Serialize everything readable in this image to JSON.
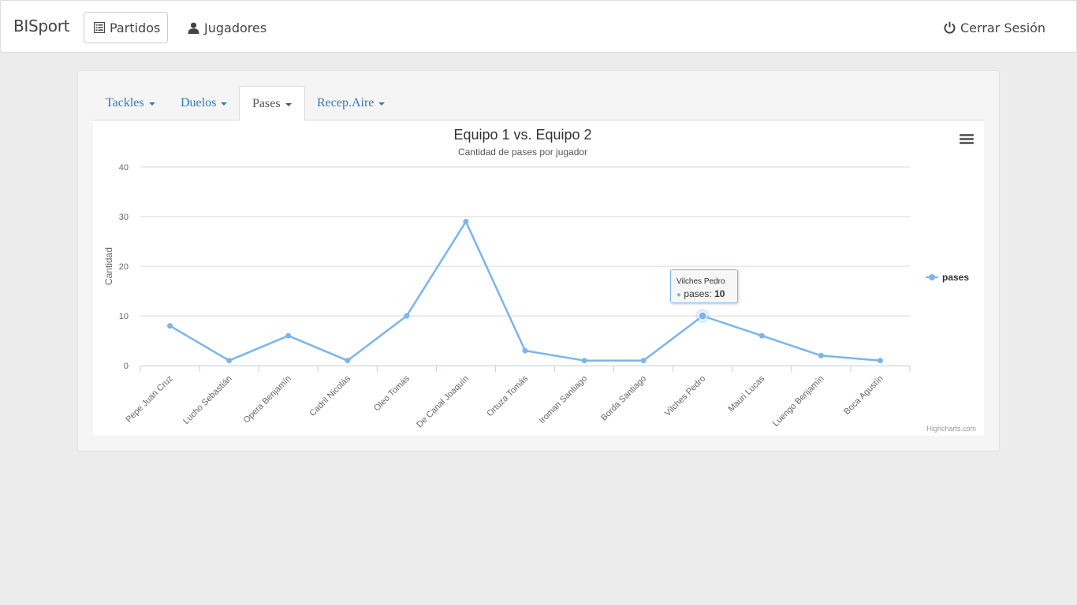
{
  "navbar": {
    "brand": "BISport",
    "items": [
      {
        "label": "Partidos",
        "icon": "list-icon",
        "active": true
      },
      {
        "label": "Jugadores",
        "icon": "user-icon",
        "active": false
      }
    ],
    "logout": {
      "label": "Cerrar Sesión",
      "icon": "power-icon"
    }
  },
  "tabs": [
    {
      "label": "Tackles",
      "active": false
    },
    {
      "label": "Duelos",
      "active": false
    },
    {
      "label": "Pases",
      "active": true
    },
    {
      "label": "Recep.Aire",
      "active": false
    }
  ],
  "chart_data": {
    "type": "line",
    "title": "Equipo 1 vs. Equipo 2",
    "subtitle": "Cantidad de pases por jugador",
    "xlabel": "",
    "ylabel": "Cantidad",
    "ylim": [
      0,
      40
    ],
    "yticks": [
      0,
      10,
      20,
      30,
      40
    ],
    "grid": true,
    "legend_position": "right",
    "color": "#7cb5ec",
    "categories": [
      "Pepe Juan Cruz",
      "Lucho Sebastián",
      "Opera Benjamín",
      "Cadril Nicolás",
      "Oleo Tomás",
      "De Canal Joaquín",
      "Ortuza Tomás",
      "Iroman Santiago",
      "Borda Santiago",
      "Vilches Pedro",
      "Mauri Lucas",
      "Luengo Benjamín",
      "Boca Agustín"
    ],
    "series": [
      {
        "name": "pases",
        "values": [
          8,
          1,
          6,
          1,
          10,
          29,
          3,
          1,
          1,
          10,
          6,
          2,
          1
        ]
      }
    ],
    "tooltip": {
      "category": "Vilches Pedro",
      "series": "pases",
      "value": 10
    }
  },
  "tooltip": {
    "title": "Vilches Pedro",
    "label": "pases:",
    "value": "10"
  },
  "credits": "Highcharts.com"
}
